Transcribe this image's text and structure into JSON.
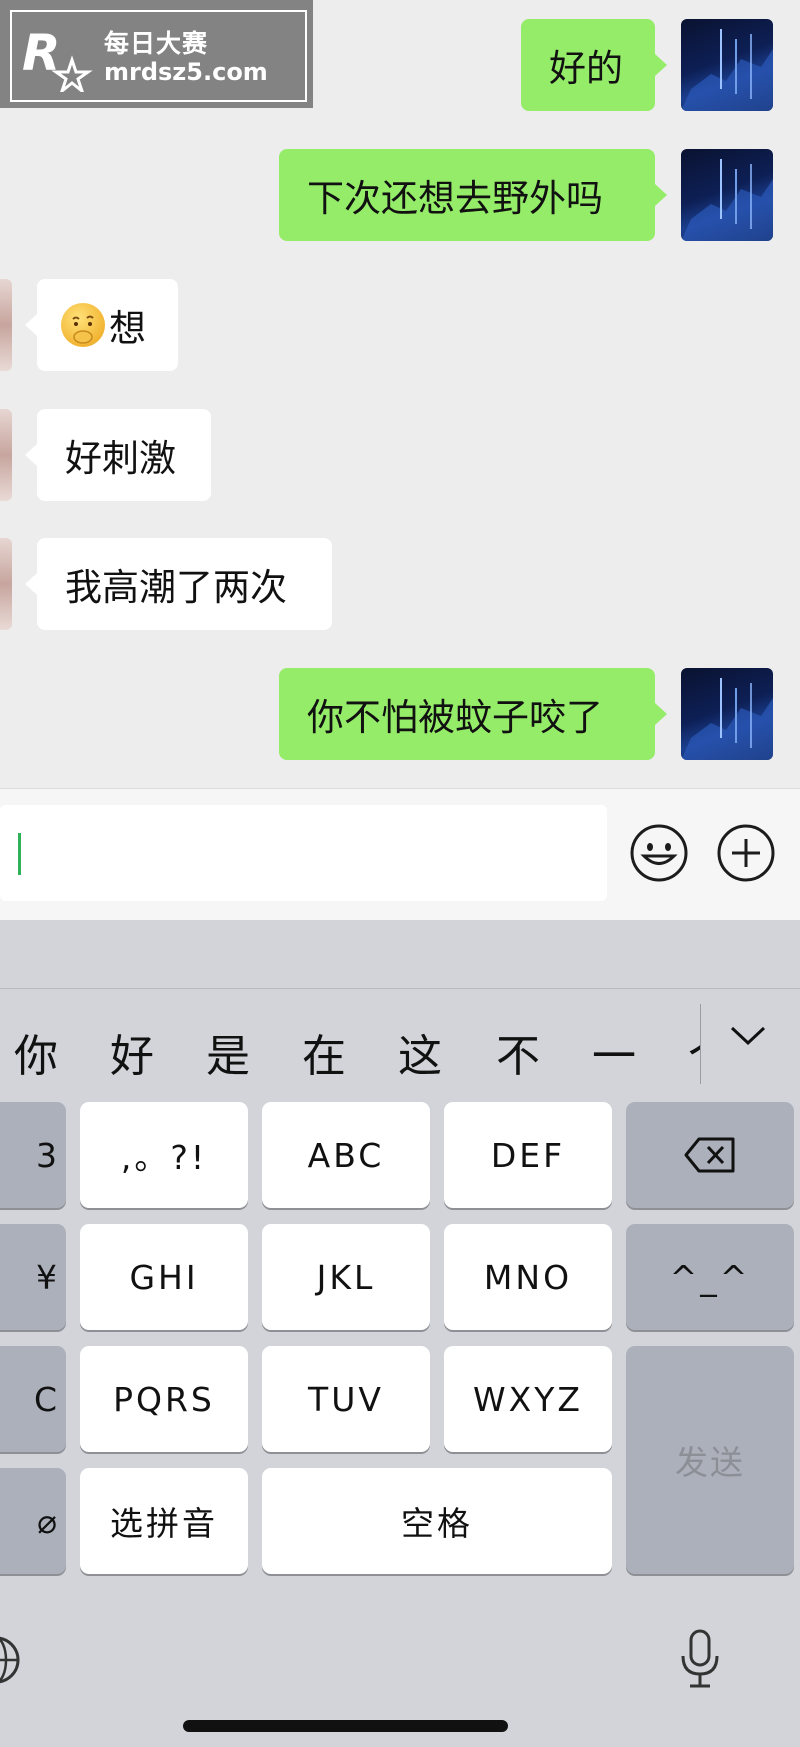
{
  "watermark": {
    "line1": "每日大赛",
    "line2": "mrdsz5.com"
  },
  "messages": [
    {
      "side": "out",
      "text": "好的"
    },
    {
      "side": "out",
      "text": "下次还想去野外吗"
    },
    {
      "side": "in",
      "text": "想",
      "emoji": "thinking-face-emoji"
    },
    {
      "side": "in",
      "text": "好刺激"
    },
    {
      "side": "in",
      "text": "我高潮了两次"
    },
    {
      "side": "out",
      "text": "你不怕被蚊子咬了"
    }
  ],
  "input": {
    "value": ""
  },
  "keyboard": {
    "candidates": [
      "你",
      "好",
      "是",
      "在",
      "这",
      "不",
      "一",
      "个"
    ],
    "keys": {
      "punct": ",。?!",
      "abc": "ABC",
      "def": "DEF",
      "ghi": "GHI",
      "jkl": "JKL",
      "mno": "MNO",
      "pqrs": "PQRS",
      "tuv": "TUV",
      "wxyz": "WXYZ",
      "select_pinyin": "选拼音",
      "space": "空格",
      "send": "发送",
      "emoticon": "^_^",
      "left_col": [
        "3",
        "¥",
        "C",
        "⌀"
      ]
    }
  },
  "colors": {
    "bubble_out": "#95ec69",
    "bubble_in": "#ffffff",
    "caret": "#2fb15a"
  }
}
